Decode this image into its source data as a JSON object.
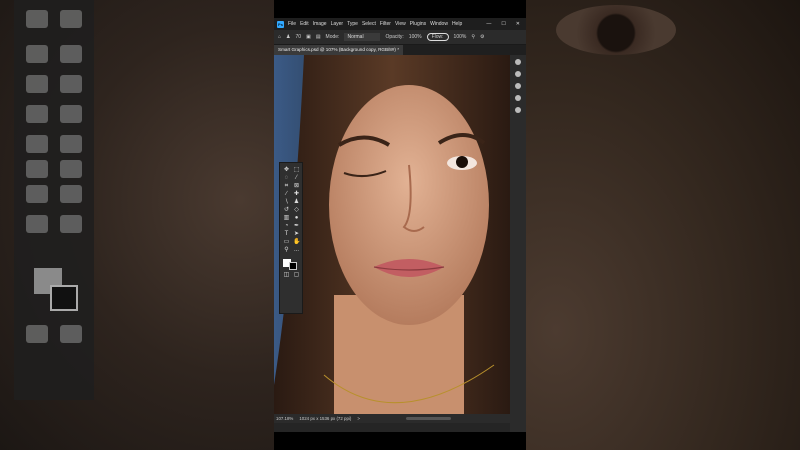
{
  "app": {
    "logo": "Ps",
    "menus": [
      "File",
      "Edit",
      "Image",
      "Layer",
      "Type",
      "Select",
      "Filter",
      "View",
      "Plugins",
      "Window",
      "Help"
    ],
    "window_controls": [
      "—",
      "☐",
      "✕"
    ]
  },
  "options": {
    "mode_label": "Mode:",
    "mode_value": "Normal",
    "opacity_label": "Opacity:",
    "opacity_value": "100%",
    "flow_label": "Flow:",
    "flow_value": "100%",
    "brush_size": "70"
  },
  "document": {
    "tab_title": "Smart Graphics.psd @ 107% (Background copy, RGB/8#) *"
  },
  "status": {
    "zoom": "107.18%",
    "info": "1024 px x 1536 px (72 ppi)",
    "arrow": ">"
  },
  "toolbar": {
    "tools": [
      "move-icon",
      "marquee-icon",
      "lasso-icon",
      "magic-wand-icon",
      "crop-icon",
      "frame-icon",
      "eyedropper-icon",
      "healing-icon",
      "brush-icon",
      "stamp-icon",
      "history-brush-icon",
      "eraser-icon",
      "gradient-icon",
      "blur-icon",
      "dodge-icon",
      "pen-icon",
      "type-icon",
      "path-select-icon",
      "shape-icon",
      "hand-icon",
      "zoom-icon"
    ],
    "more": "..."
  }
}
